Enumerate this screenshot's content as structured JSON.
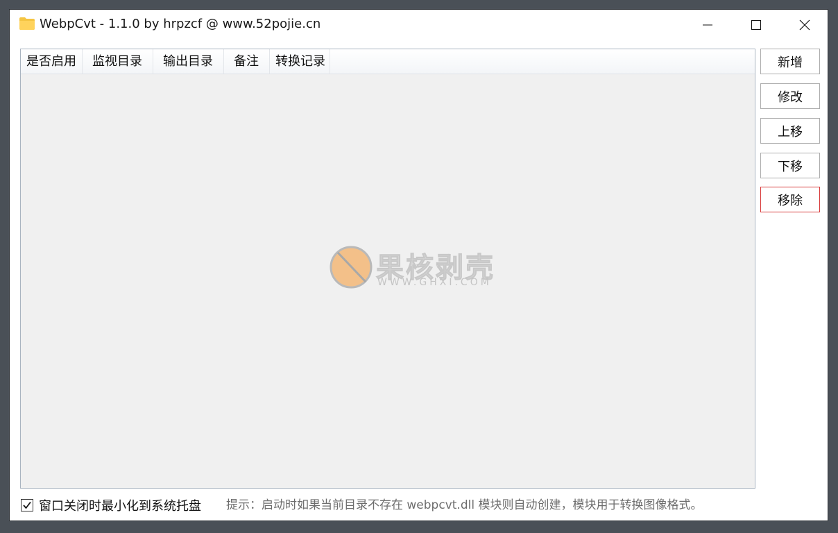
{
  "window": {
    "title": "WebpCvt - 1.1.0 by hrpzcf @ www.52pojie.cn"
  },
  "list": {
    "columns": [
      "是否启用",
      "监视目录",
      "输出目录",
      "备注",
      "转换记录"
    ]
  },
  "watermark": {
    "title": "果核剥壳",
    "subtitle": "WWW.GHXI.COM"
  },
  "buttons": {
    "add": "新增",
    "edit": "修改",
    "move_up": "上移",
    "move_down": "下移",
    "remove": "移除"
  },
  "options": {
    "minimize_to_tray_label": "窗口关闭时最小化到系统托盘",
    "minimize_to_tray_checked": true
  },
  "hint": "提示：启动时如果当前目录不存在 webpcvt.dll 模块则自动创建，模块用于转换图像格式。",
  "colors": {
    "remove_border": "#d83a3a",
    "folder_icon": "#f5c542",
    "watermark_circle": "#f3c089"
  }
}
